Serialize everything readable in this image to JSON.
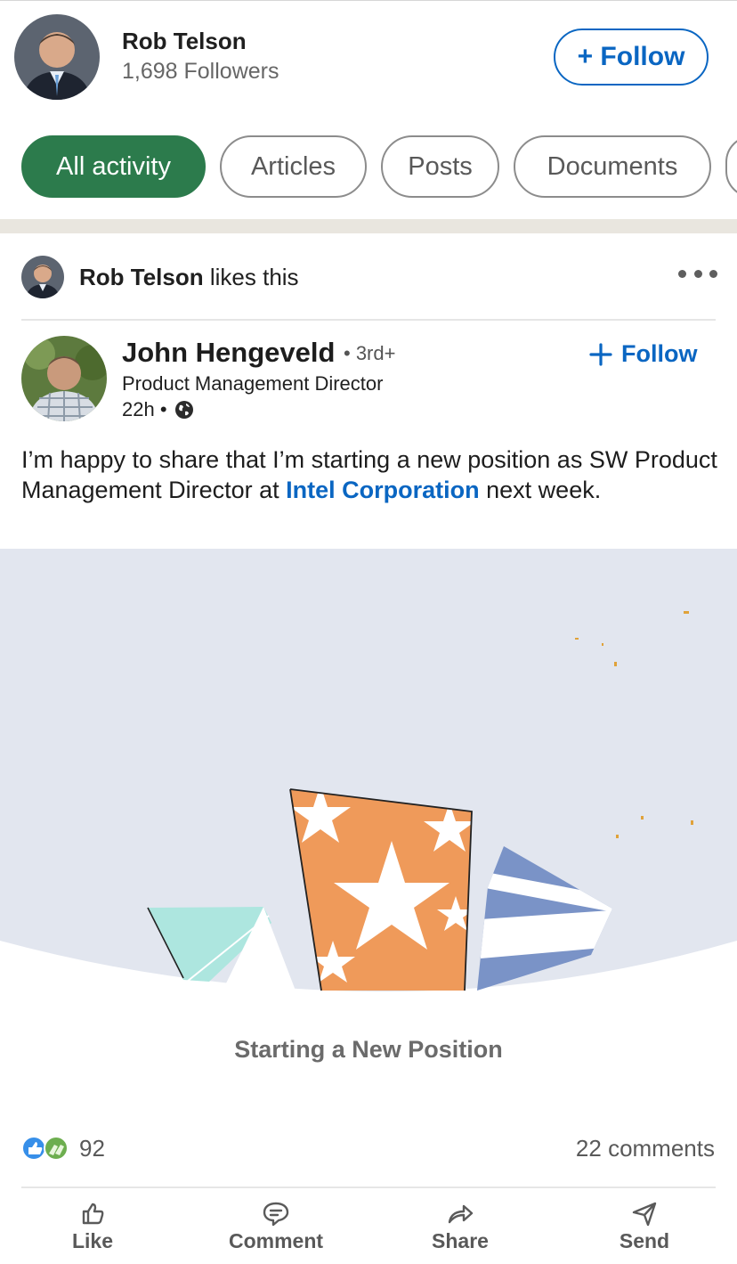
{
  "header": {
    "name": "Rob Telson",
    "followers": "1,698 Followers",
    "follow_label": "+ Follow"
  },
  "filters": [
    {
      "label": "All activity",
      "active": true
    },
    {
      "label": "Articles",
      "active": false
    },
    {
      "label": "Posts",
      "active": false
    },
    {
      "label": "Documents",
      "active": false
    }
  ],
  "activity": {
    "actor": "Rob Telson",
    "action": "likes this"
  },
  "post": {
    "author": "John Hengeveld",
    "degree": "• 3rd+",
    "title": "Product Management Director",
    "time": "22h •",
    "follow_label": "Follow",
    "text_before": "I’m happy to share that I’m starting a new position as SW Product Management Director at ",
    "text_link": "Intel Corporation",
    "text_after": " next week.",
    "image_caption": "Starting a New Position"
  },
  "social": {
    "reaction_count": "92",
    "comments": "22 comments"
  },
  "actions": [
    {
      "label": "Like",
      "icon": "thumbs-up-icon"
    },
    {
      "label": "Comment",
      "icon": "comment-icon"
    },
    {
      "label": "Share",
      "icon": "share-arrow-icon"
    },
    {
      "label": "Send",
      "icon": "paper-plane-icon"
    }
  ],
  "colors": {
    "brand_blue": "#0a66c2",
    "active_chip": "#2c7b4c",
    "banner_bg": "#e2e6ef",
    "orange_flag": "#ef9a5a",
    "blue_flag": "#7a93c7",
    "teal_flag": "#ade6df"
  }
}
